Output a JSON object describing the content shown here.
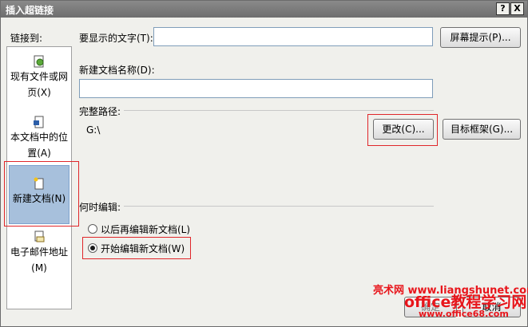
{
  "window": {
    "title": "插入超链接",
    "help_btn": "?",
    "close_btn": "X"
  },
  "link_to": {
    "label": "链接到:",
    "items": [
      {
        "label": "现有文件或网页(X)",
        "icon": "web-page-icon"
      },
      {
        "label": "本文档中的位置(A)",
        "icon": "document-place-icon"
      },
      {
        "label": "新建文档(N)",
        "icon": "new-document-icon",
        "selected": true
      },
      {
        "label": "电子邮件地址(M)",
        "icon": "email-icon"
      }
    ]
  },
  "display_text": {
    "label": "要显示的文字(T):",
    "value": ""
  },
  "screen_tip_button": "屏幕提示(P)...",
  "new_doc_name": {
    "label": "新建文档名称(D):",
    "value": ""
  },
  "full_path": {
    "label": "完整路径:",
    "value": "G:\\"
  },
  "change_button": "更改(C)...",
  "target_frame_button": "目标框架(G)...",
  "when_edit": {
    "label": "何时编辑:",
    "options": [
      {
        "label": "以后再编辑新文档(L)",
        "selected": false
      },
      {
        "label": "开始编辑新文档(W)",
        "selected": true
      }
    ]
  },
  "ok_button": "确定",
  "cancel_button": "取消",
  "watermark": {
    "line1": "亮术网 www.liangshunet.com",
    "line2": "office教程学习网",
    "line3": "www.office68.com"
  },
  "accent_colors": {
    "highlight_red": "#e0262a",
    "selected_bg": "#a7c0dc",
    "watermark_red": "#e8151b"
  }
}
